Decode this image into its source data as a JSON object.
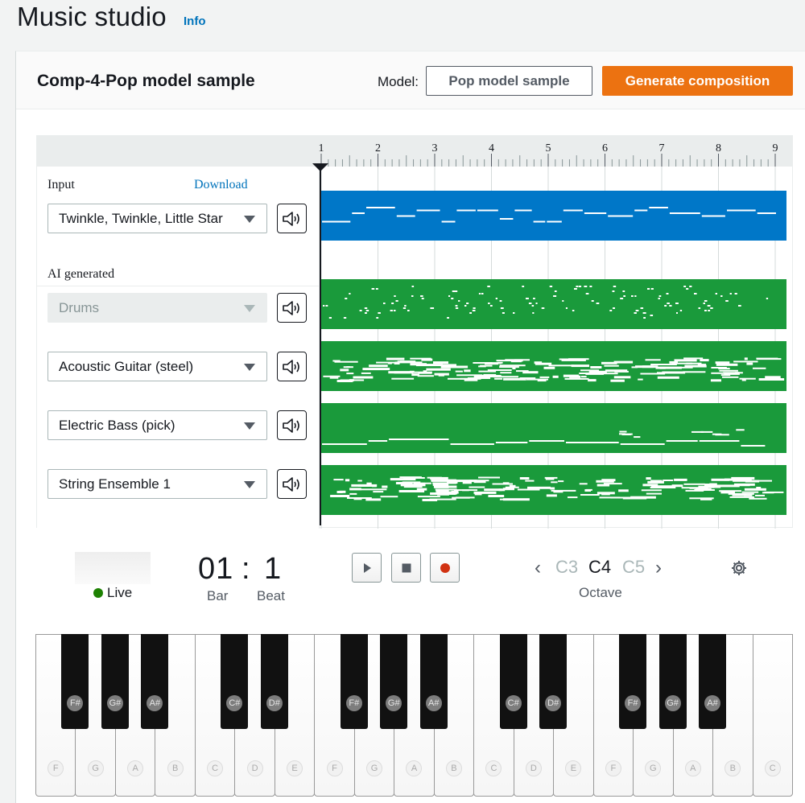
{
  "header": {
    "title": "Music studio",
    "info": "Info"
  },
  "panel": {
    "sample_title": "Comp-4-Pop model sample",
    "model_label": "Model:",
    "model_value": "Pop model sample",
    "generate_label": "Generate composition"
  },
  "timeline": {
    "bars": [
      "1",
      "2",
      "3",
      "4",
      "5",
      "6",
      "7",
      "8",
      "9"
    ],
    "input_label": "Input",
    "download_label": "Download",
    "ai_label": "AI generated",
    "tracks": [
      {
        "instrument": "Twinkle, Twinkle, Little Star",
        "kind": "input",
        "enabled": true
      },
      {
        "instrument": "Drums",
        "kind": "ai",
        "enabled": false
      },
      {
        "instrument": "Acoustic Guitar (steel)",
        "kind": "ai",
        "enabled": true
      },
      {
        "instrument": "Electric Bass (pick)",
        "kind": "ai",
        "enabled": true
      },
      {
        "instrument": "String Ensemble 1",
        "kind": "ai",
        "enabled": true
      }
    ],
    "colors": {
      "input": "#0077c8",
      "ai": "#1a9a3b"
    }
  },
  "transport": {
    "live": "Live",
    "bar": "01",
    "separator": ":",
    "beat": "1",
    "bar_label": "Bar",
    "beat_label": "Beat",
    "octaves": [
      "C3",
      "C4",
      "C5"
    ],
    "octave_label": "Octave"
  },
  "keyboard": {
    "white_keys": [
      "F",
      "G",
      "A",
      "B",
      "C",
      "D",
      "E",
      "F",
      "G",
      "A",
      "B",
      "C",
      "D",
      "E",
      "F",
      "G",
      "A",
      "B",
      "C"
    ],
    "black_keys": [
      "F#",
      "G#",
      "A#",
      "C#",
      "D#",
      "F#",
      "G#",
      "A#",
      "C#",
      "D#",
      "F#",
      "G#",
      "A#"
    ]
  }
}
